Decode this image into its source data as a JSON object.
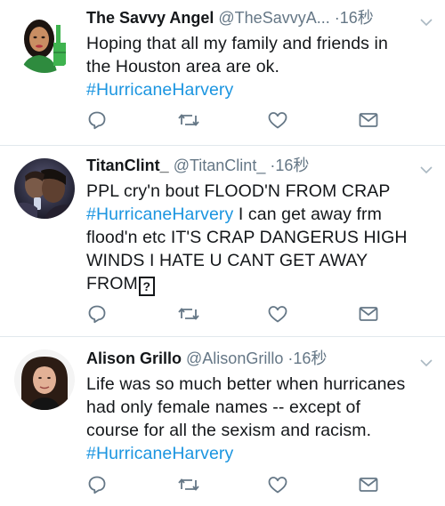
{
  "tweets": [
    {
      "name": "The Savvy Angel",
      "handle": "@TheSavvyA...",
      "time": "16秒",
      "line1": "Hoping that all my family and friends in",
      "line2": "the Houston area are ok.",
      "line3": "#HurricaneHarvery"
    },
    {
      "name": "TitanClint_",
      "handle": "@TitanClint_",
      "time": "16秒",
      "line1": "PPL cry'n bout FLOOD'N FROM CRAP",
      "line2_hashtag": "#HurricaneHarvery",
      "line2_rest": " I can get away frm",
      "line3": "flood'n etc IT'S CRAP DANGERUS HIGH",
      "line4": "WINDS I HATE U CANT GET AWAY",
      "line5": "FROM",
      "unknown_glyph": "?"
    },
    {
      "name": "Alison Grillo",
      "handle": "@AlisonGrillo",
      "time": "16秒",
      "line1": "Life was so much better when hurricanes",
      "line2": "had only female names -- except of",
      "line3": "course for all the sexism and racism.",
      "line4": "#HurricaneHarvery"
    }
  ],
  "separator": "·",
  "colors": {
    "text": "#14171a",
    "secondary": "#657786",
    "hashtag": "#1b95e0",
    "divider": "#e1e8ed"
  },
  "icons": [
    "reply-icon",
    "retweet-icon",
    "like-icon",
    "message-icon",
    "chevron-down-icon"
  ]
}
